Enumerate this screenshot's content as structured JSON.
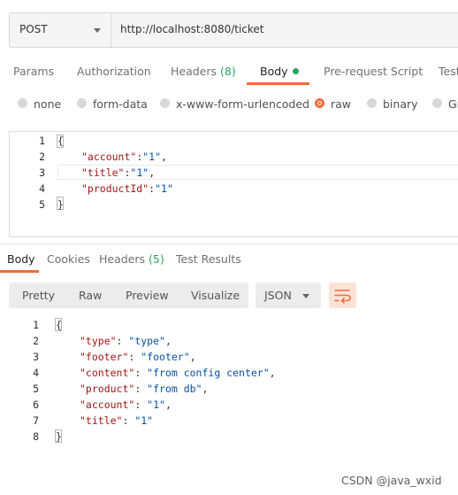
{
  "request": {
    "method": "POST",
    "url": "http://localhost:8080/ticket"
  },
  "request_tabs": [
    {
      "label": "Params"
    },
    {
      "label": "Authorization"
    },
    {
      "label": "Headers",
      "count": "(8)"
    },
    {
      "label": "Body",
      "active": true
    },
    {
      "label": "Pre-request Script"
    },
    {
      "label": "Test"
    }
  ],
  "body_types": [
    {
      "label": "none"
    },
    {
      "label": "form-data"
    },
    {
      "label": "x-www-form-urlencoded"
    },
    {
      "label": "raw",
      "selected": true
    },
    {
      "label": "binary"
    },
    {
      "label": "Gr"
    }
  ],
  "request_body": {
    "line_numbers": [
      "1",
      "2",
      "3",
      "4",
      "5"
    ],
    "lines": [
      {
        "open": "{"
      },
      {
        "key": "\"account\"",
        "sep": ":",
        "value": "\"1\"",
        "end": ","
      },
      {
        "key": "\"title\"",
        "sep": ":",
        "value": "\"1\"",
        "end": ","
      },
      {
        "key": "\"productId\"",
        "sep": ":",
        "value": "\"1\"",
        "end": ""
      },
      {
        "close": "}"
      }
    ]
  },
  "response_tabs": [
    {
      "label": "Body",
      "active": true
    },
    {
      "label": "Cookies"
    },
    {
      "label": "Headers",
      "count": "(5)"
    },
    {
      "label": "Test Results"
    }
  ],
  "view_modes": [
    "Pretty",
    "Raw",
    "Preview",
    "Visualize"
  ],
  "format_select": "JSON",
  "wrap_icon": "wrap-lines-icon",
  "response_body": {
    "line_numbers": [
      "1",
      "2",
      "3",
      "4",
      "5",
      "6",
      "7",
      "8"
    ],
    "lines": [
      {
        "open": "{"
      },
      {
        "key": "\"type\"",
        "sep": ": ",
        "value": "\"type\"",
        "end": ","
      },
      {
        "key": "\"footer\"",
        "sep": ": ",
        "value": "\"footer\"",
        "end": ","
      },
      {
        "key": "\"content\"",
        "sep": ": ",
        "value": "\"from config center\"",
        "end": ","
      },
      {
        "key": "\"product\"",
        "sep": ": ",
        "value": "\"from db\"",
        "end": ","
      },
      {
        "key": "\"account\"",
        "sep": ": ",
        "value": "\"1\"",
        "end": ","
      },
      {
        "key": "\"title\"",
        "sep": ": ",
        "value": "\"1\"",
        "end": ""
      },
      {
        "close": "}"
      }
    ]
  },
  "watermark": "CSDN @java_wxid",
  "colors": {
    "accent": "#f26b3a",
    "count_green": "#26a65b",
    "json_key": "#a31515",
    "json_value": "#0451a5"
  }
}
